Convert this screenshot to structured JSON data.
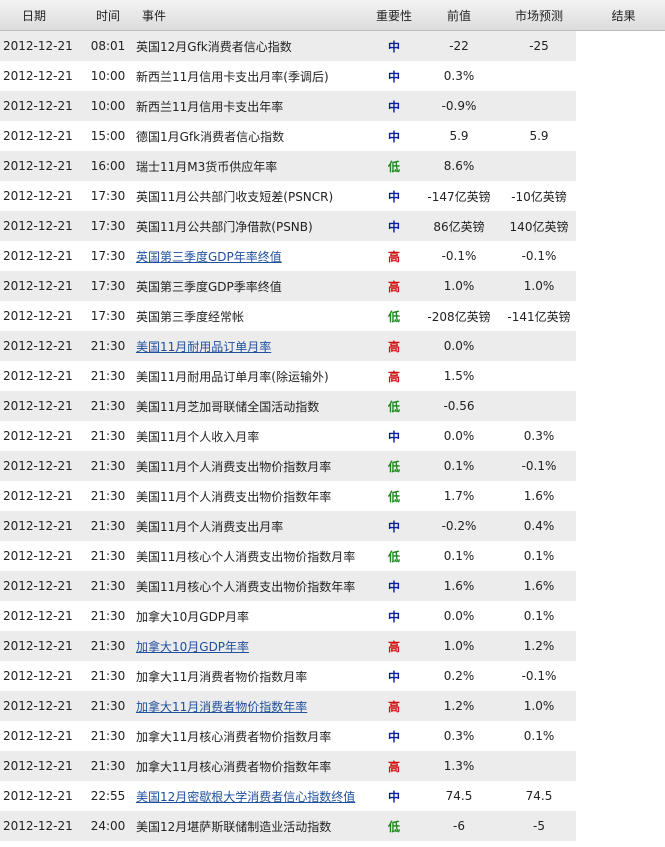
{
  "colors": {
    "high": "#d01010",
    "mid": "#0a1f9c",
    "low": "#1b8a1b",
    "link": "#1f4f9d",
    "row_alt": "#ececec"
  },
  "header": {
    "date": "日期",
    "time": "时间",
    "event": "事件",
    "importance": "重要性",
    "previous": "前值",
    "forecast": "市场预测",
    "result": "结果"
  },
  "rows": [
    {
      "date": "2012-12-21",
      "time": "08:01",
      "event": "英国12月Gfk消费者信心指数",
      "link": false,
      "importance": "中",
      "level": "mid",
      "previous": "-22",
      "forecast": "-25",
      "result": ""
    },
    {
      "date": "2012-12-21",
      "time": "10:00",
      "event": "新西兰11月信用卡支出月率(季调后)",
      "link": false,
      "importance": "中",
      "level": "mid",
      "previous": "0.3%",
      "forecast": "",
      "result": ""
    },
    {
      "date": "2012-12-21",
      "time": "10:00",
      "event": "新西兰11月信用卡支出年率",
      "link": false,
      "importance": "中",
      "level": "mid",
      "previous": "-0.9%",
      "forecast": "",
      "result": ""
    },
    {
      "date": "2012-12-21",
      "time": "15:00",
      "event": "德国1月Gfk消费者信心指数",
      "link": false,
      "importance": "中",
      "level": "mid",
      "previous": "5.9",
      "forecast": "5.9",
      "result": ""
    },
    {
      "date": "2012-12-21",
      "time": "16:00",
      "event": "瑞士11月M3货币供应年率",
      "link": false,
      "importance": "低",
      "level": "low",
      "previous": "8.6%",
      "forecast": "",
      "result": ""
    },
    {
      "date": "2012-12-21",
      "time": "17:30",
      "event": "英国11月公共部门收支短差(PSNCR)",
      "link": false,
      "importance": "中",
      "level": "mid",
      "previous": "-147亿英镑",
      "forecast": "-10亿英镑",
      "result": ""
    },
    {
      "date": "2012-12-21",
      "time": "17:30",
      "event": "英国11月公共部门净借款(PSNB)",
      "link": false,
      "importance": "中",
      "level": "mid",
      "previous": "86亿英镑",
      "forecast": "140亿英镑",
      "result": ""
    },
    {
      "date": "2012-12-21",
      "time": "17:30",
      "event": "英国第三季度GDP年率终值",
      "link": true,
      "importance": "高",
      "level": "high",
      "previous": "-0.1%",
      "forecast": "-0.1%",
      "result": ""
    },
    {
      "date": "2012-12-21",
      "time": "17:30",
      "event": "英国第三季度GDP季率终值",
      "link": false,
      "importance": "高",
      "level": "high",
      "previous": "1.0%",
      "forecast": "1.0%",
      "result": ""
    },
    {
      "date": "2012-12-21",
      "time": "17:30",
      "event": "英国第三季度经常帐",
      "link": false,
      "importance": "低",
      "level": "low",
      "previous": "-208亿英镑",
      "forecast": "-141亿英镑",
      "result": ""
    },
    {
      "date": "2012-12-21",
      "time": "21:30",
      "event": "美国11月耐用品订单月率",
      "link": true,
      "importance": "高",
      "level": "high",
      "previous": "0.0%",
      "forecast": "",
      "result": ""
    },
    {
      "date": "2012-12-21",
      "time": "21:30",
      "event": "美国11月耐用品订单月率(除运输外)",
      "link": false,
      "importance": "高",
      "level": "high",
      "previous": "1.5%",
      "forecast": "",
      "result": ""
    },
    {
      "date": "2012-12-21",
      "time": "21:30",
      "event": "美国11月芝加哥联储全国活动指数",
      "link": false,
      "importance": "低",
      "level": "low",
      "previous": "-0.56",
      "forecast": "",
      "result": ""
    },
    {
      "date": "2012-12-21",
      "time": "21:30",
      "event": "美国11月个人收入月率",
      "link": false,
      "importance": "中",
      "level": "mid",
      "previous": "0.0%",
      "forecast": "0.3%",
      "result": ""
    },
    {
      "date": "2012-12-21",
      "time": "21:30",
      "event": "美国11月个人消费支出物价指数月率",
      "link": false,
      "importance": "低",
      "level": "low",
      "previous": "0.1%",
      "forecast": "-0.1%",
      "result": ""
    },
    {
      "date": "2012-12-21",
      "time": "21:30",
      "event": "美国11月个人消费支出物价指数年率",
      "link": false,
      "importance": "低",
      "level": "low",
      "previous": "1.7%",
      "forecast": "1.6%",
      "result": ""
    },
    {
      "date": "2012-12-21",
      "time": "21:30",
      "event": "美国11月个人消费支出月率",
      "link": false,
      "importance": "中",
      "level": "mid",
      "previous": "-0.2%",
      "forecast": "0.4%",
      "result": ""
    },
    {
      "date": "2012-12-21",
      "time": "21:30",
      "event": "美国11月核心个人消费支出物价指数月率",
      "link": false,
      "importance": "低",
      "level": "low",
      "previous": "0.1%",
      "forecast": "0.1%",
      "result": ""
    },
    {
      "date": "2012-12-21",
      "time": "21:30",
      "event": "美国11月核心个人消费支出物价指数年率",
      "link": false,
      "importance": "中",
      "level": "mid",
      "previous": "1.6%",
      "forecast": "1.6%",
      "result": ""
    },
    {
      "date": "2012-12-21",
      "time": "21:30",
      "event": "加拿大10月GDP月率",
      "link": false,
      "importance": "中",
      "level": "mid",
      "previous": "0.0%",
      "forecast": "0.1%",
      "result": ""
    },
    {
      "date": "2012-12-21",
      "time": "21:30",
      "event": "加拿大10月GDP年率",
      "link": true,
      "importance": "高",
      "level": "high",
      "previous": "1.0%",
      "forecast": "1.2%",
      "result": ""
    },
    {
      "date": "2012-12-21",
      "time": "21:30",
      "event": "加拿大11月消费者物价指数月率",
      "link": false,
      "importance": "中",
      "level": "mid",
      "previous": "0.2%",
      "forecast": "-0.1%",
      "result": ""
    },
    {
      "date": "2012-12-21",
      "time": "21:30",
      "event": "加拿大11月消费者物价指数年率",
      "link": true,
      "importance": "高",
      "level": "high",
      "previous": "1.2%",
      "forecast": "1.0%",
      "result": ""
    },
    {
      "date": "2012-12-21",
      "time": "21:30",
      "event": "加拿大11月核心消费者物价指数月率",
      "link": false,
      "importance": "中",
      "level": "mid",
      "previous": "0.3%",
      "forecast": "0.1%",
      "result": ""
    },
    {
      "date": "2012-12-21",
      "time": "21:30",
      "event": "加拿大11月核心消费者物价指数年率",
      "link": false,
      "importance": "高",
      "level": "high",
      "previous": "1.3%",
      "forecast": "",
      "result": ""
    },
    {
      "date": "2012-12-21",
      "time": "22:55",
      "event": "美国12月密歇根大学消费者信心指数终值",
      "link": true,
      "importance": "中",
      "level": "mid",
      "previous": "74.5",
      "forecast": "74.5",
      "result": ""
    },
    {
      "date": "2012-12-21",
      "time": "24:00",
      "event": "美国12月堪萨斯联储制造业活动指数",
      "link": false,
      "importance": "低",
      "level": "low",
      "previous": "-6",
      "forecast": "-5",
      "result": ""
    }
  ]
}
